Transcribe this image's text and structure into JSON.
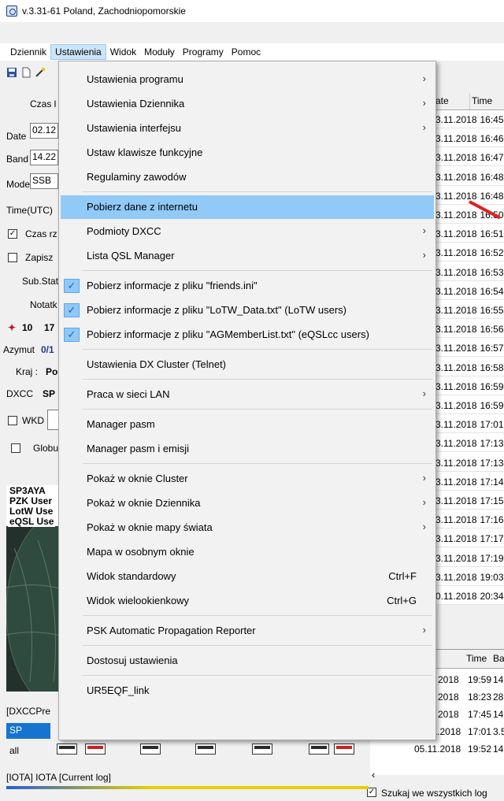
{
  "window": {
    "title": "v.3.31-61 Poland, Zachodniopomorskie"
  },
  "menubar": {
    "items": [
      "Dziennik",
      "Ustawienia",
      "Widok",
      "Moduły",
      "Programy",
      "Pomoc"
    ],
    "active": "Ustawienia"
  },
  "left_panel": {
    "czas_label": "Czas l",
    "date_label": "Date",
    "date_value": "02.12",
    "band_label": "Band",
    "band_value": "14.22",
    "mode_label": "Mode",
    "mode_value": "SSB",
    "time_label": "Time(UTC)",
    "czas_rz_label": "Czas rz",
    "zapisz_label": "Zapisz",
    "substat_label": "Sub.Stat",
    "notatk_label": "Notatk",
    "counter_a": "10",
    "counter_b": "17",
    "azymut_label": "Azymut",
    "azymut_value": "0/1",
    "kraj_label": "Kraj :",
    "kraj_value": "Po",
    "dxcc_label": "DXCC",
    "dxcc_value": "SP",
    "wkd_label": "WKD",
    "globu_label": "Globu",
    "info_lines": [
      "SP3AYA",
      "PZK User",
      "LotW Use",
      "eQSL Use"
    ],
    "dxccpref_label": "[DXCCPre",
    "sp_row": "SP",
    "all_row": "all",
    "iota_label": "[IOTA] IOTA [Current log]"
  },
  "log_grid": {
    "headers": [
      "ate",
      "Time"
    ],
    "rows": [
      [
        "3.11.2018",
        "16:45"
      ],
      [
        "3.11.2018",
        "16:46"
      ],
      [
        "3.11.2018",
        "16:47"
      ],
      [
        "3.11.2018",
        "16:48"
      ],
      [
        "3.11.2018",
        "16:48"
      ],
      [
        "3.11.2018",
        "16:50"
      ],
      [
        "3.11.2018",
        "16:51"
      ],
      [
        "3.11.2018",
        "16:52"
      ],
      [
        "3.11.2018",
        "16:53"
      ],
      [
        "3.11.2018",
        "16:54"
      ],
      [
        "3.11.2018",
        "16:55"
      ],
      [
        "3.11.2018",
        "16:56"
      ],
      [
        "3.11.2018",
        "16:57"
      ],
      [
        "3.11.2018",
        "16:58"
      ],
      [
        "3.11.2018",
        "16:59"
      ],
      [
        "3.11.2018",
        "16:59"
      ],
      [
        "3.11.2018",
        "17:01"
      ],
      [
        "3.11.2018",
        "17:13"
      ],
      [
        "3.11.2018",
        "17:13"
      ],
      [
        "3.11.2018",
        "17:14"
      ],
      [
        "3.11.2018",
        "17:15"
      ],
      [
        "3.11.2018",
        "17:16"
      ],
      [
        "3.11.2018",
        "17:17"
      ],
      [
        "3.11.2018",
        "17:19"
      ],
      [
        "3.11.2018",
        "19:03"
      ],
      [
        "0.11.2018",
        "20:34"
      ]
    ]
  },
  "grid2": {
    "headers": [
      "Time",
      "Ba"
    ],
    "rows": [
      [
        "2018",
        "19:59",
        "14"
      ],
      [
        "2018",
        "18:23",
        "28"
      ],
      [
        "2018",
        "17:45",
        "14"
      ],
      [
        "07.11.2018",
        "17:01",
        "3.5"
      ],
      [
        "05.11.2018",
        "19:52",
        "14"
      ]
    ],
    "search_all_label": "Szukaj we wszystkich log"
  },
  "dropdown": {
    "items": [
      {
        "label": "Ustawienia programu",
        "submenu": true
      },
      {
        "label": "Ustawienia Dziennika",
        "submenu": true
      },
      {
        "label": "Ustawienia interfejsu",
        "submenu": true
      },
      {
        "label": "Ustaw klawisze funkcyjne"
      },
      {
        "label": "Regulaminy zawodów"
      },
      {
        "label": "Pobierz dane z internetu",
        "highlighted": true
      },
      {
        "label": "Podmioty DXCC",
        "submenu": true
      },
      {
        "label": "Lista QSL Manager",
        "submenu": true
      },
      {
        "label": "Pobierz informacje z pliku \"friends.ini\"",
        "checked": true
      },
      {
        "label": "Pobierz informacje z pliku \"LoTW_Data.txt\" (LoTW users)",
        "checked": true
      },
      {
        "label": "Pobierz informacje z pliku \"AGMemberList.txt\" (eQSLcc users)",
        "checked": true
      },
      {
        "label": "Ustawienia DX Cluster (Telnet)"
      },
      {
        "label": "Praca w sieci LAN",
        "submenu": true
      },
      {
        "label": "Manager pasm"
      },
      {
        "label": "Manager pasm i emisji"
      },
      {
        "label": "Pokaż w oknie Cluster",
        "submenu": true
      },
      {
        "label": "Pokaż w oknie Dziennika",
        "submenu": true
      },
      {
        "label": "Pokaż w oknie mapy świata",
        "submenu": true
      },
      {
        "label": "Mapa w osobnym oknie"
      },
      {
        "label": "Widok standardowy",
        "shortcut": "Ctrl+F"
      },
      {
        "label": "Widok wielookienkowy",
        "shortcut": "Ctrl+G"
      },
      {
        "label": "PSK Automatic Propagation Reporter",
        "submenu": true
      },
      {
        "label": "Dostosuj ustawienia"
      },
      {
        "label": "UR5EQF_link"
      }
    ]
  },
  "colors": {
    "highlight": "#91c9f7",
    "check_bg": "#90c8f6",
    "menu_active": "#cce4f7",
    "annotation_arrow": "#e02020"
  }
}
